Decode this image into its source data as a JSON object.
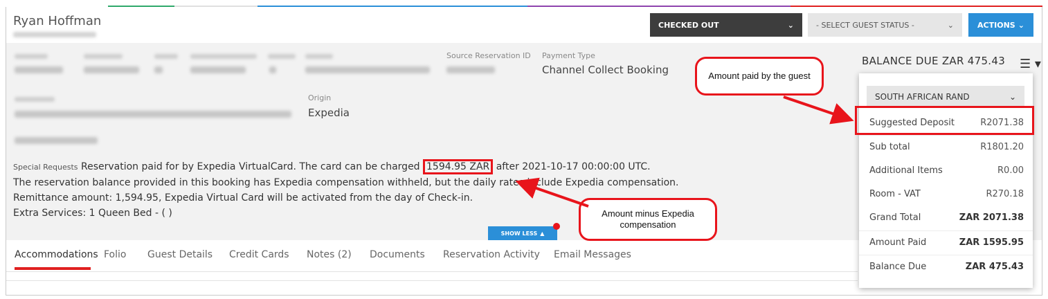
{
  "header": {
    "guest_name": "Ryan Hoffman",
    "checked_out_label": "CHECKED OUT",
    "guest_status_label": "- SELECT GUEST STATUS -",
    "actions_label": "ACTIONS"
  },
  "reservation": {
    "payment_type_label": "Payment Type",
    "payment_type_value": "Channel Collect Booking",
    "source_reservation_id_label": "Source Reservation ID",
    "origin_label": "Origin",
    "origin_value": "Expedia",
    "special_requests_label": "Special Requests",
    "special_line1_a": "Reservation paid for by Expedia VirtualCard. The card can be charged",
    "special_charged": "1594.95 ZAR",
    "special_line1_b": "after 2021-10-17 00:00:00 UTC.",
    "special_line2": "The reservation balance provided in this booking has Expedia compensation withheld, but the daily rates include Expedia compensation.",
    "special_line3": "Remittance amount: 1,594.95, Expedia Virtual Card will be activated from the day of Check-in.",
    "special_line4": "Extra Services: 1 Queen Bed - ( )",
    "show_less_label": "SHOW LESS"
  },
  "balance": {
    "title": "BALANCE DUE ZAR 475.43",
    "currency": "SOUTH AFRICAN RAND",
    "rows": [
      {
        "label": "Suggested Deposit",
        "amount": "R2071.38"
      },
      {
        "label": "Sub total",
        "amount": "R1801.20"
      },
      {
        "label": "Additional Items",
        "amount": "R0.00"
      },
      {
        "label": "Room - VAT",
        "amount": "R270.18"
      },
      {
        "label": "Grand Total",
        "amount": "ZAR 2071.38"
      },
      {
        "label": "Amount Paid",
        "amount": "ZAR 1595.95"
      },
      {
        "label": "Balance Due",
        "amount": "ZAR 475.43"
      }
    ]
  },
  "tabs": [
    {
      "label": "Accommodations"
    },
    {
      "label": "Folio"
    },
    {
      "label": "Guest Details"
    },
    {
      "label": "Credit Cards"
    },
    {
      "label": "Notes (2)"
    },
    {
      "label": "Documents"
    },
    {
      "label": "Reservation Activity"
    },
    {
      "label": "Email Messages"
    }
  ],
  "annotations": {
    "amount_paid_callout": "Amount paid by the guest",
    "minus_compensation_callout": "Amount minus Expedia compensation"
  },
  "colors": {
    "accent_blue": "#2b8fd8",
    "dark_button": "#3d3d3d",
    "annotation_red": "#e8141b",
    "active_tab_underline": "#e02020"
  },
  "icons": {
    "dropdown_caret": "chevron-down-icon",
    "menu": "hamburger-icon",
    "show_less": "chevron-up-icon"
  }
}
